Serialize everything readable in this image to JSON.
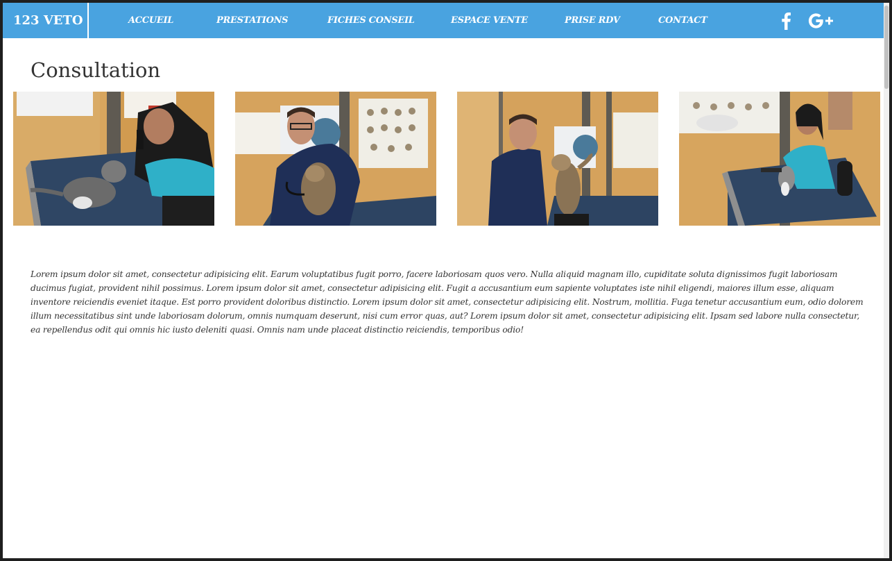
{
  "brand": "123 VETO",
  "nav": {
    "items": [
      {
        "label": "ACCUEIL"
      },
      {
        "label": "PRESTATIONS"
      },
      {
        "label": "FICHES CONSEIL"
      },
      {
        "label": "ESPACE VENTE"
      },
      {
        "label": "PRISE RDV"
      },
      {
        "label": "CONTACT"
      }
    ]
  },
  "social": {
    "facebook_icon": "facebook-icon",
    "googleplus_icon": "google-plus-icon",
    "googleplus_text": "G+"
  },
  "page": {
    "title": "Consultation",
    "body": "Lorem ipsum dolor sit amet, consectetur adipisicing elit. Earum voluptatibus fugit porro, facere laboriosam quos vero. Nulla aliquid magnam illo, cupiditate soluta dignissimos fugit laboriosam ducimus fugiat, provident nihil possimus. Lorem ipsum dolor sit amet, consectetur adipisicing elit. Fugit a accusantium eum sapiente voluptates iste nihil eligendi, maiores illum esse, aliquam inventore reiciendis eveniet itaque. Est porro provident doloribus distinctio. Lorem ipsum dolor sit amet, consectetur adipisicing elit. Nostrum, mollitia. Fuga tenetur accusantium eum, odio dolorem illum necessitatibus sint unde laboriosam dolorum, omnis numquam deserunt, nisi cum error quas, aut? Lorem ipsum dolor sit amet, consectetur adipisicing elit. Ipsam sed labore nulla consectetur, ea repellendus odit qui omnis hic iusto deleniti quasi. Omnis nam unde placeat distinctio reiciendis, temporibus odio!"
  },
  "colors": {
    "navbar": "#49a3e0",
    "text": "#333333"
  }
}
